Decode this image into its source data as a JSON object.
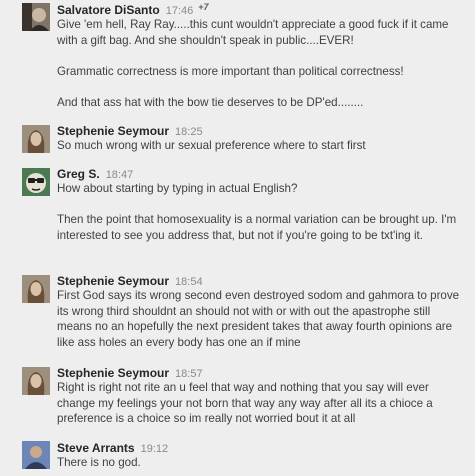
{
  "comments": [
    {
      "author": "Salvatore DiSanto",
      "time": "17:46",
      "plus_count": "+7",
      "lines": [
        "Give 'em hell, Ray Ray.....this cunt wouldn't appreciate a good fuck if it came with a gift bag. And she shouldn't speak in public....EVER!",
        "",
        "Grammatic correctness is more important than political correctness!",
        "",
        "And that ass hat with the bow tie deserves to be DP'ed........"
      ]
    },
    {
      "author": "Stephenie Seymour",
      "time": "18:25",
      "lines": [
        "So much wrong with ur sexual preference where to start first"
      ]
    },
    {
      "author": "Greg S.",
      "time": "18:47",
      "lines": [
        "How about starting by typing in actual English?",
        "",
        "Then the point that homosexuality is a normal variation can be brought up.  I'm interested to see you address that, but not if you're going to be txt'ing it."
      ]
    },
    {
      "author": "Stephenie Seymour",
      "time": "18:54",
      "lines": [
        "First God says its wrong second even destroyed sodom and gahmora to prove its wrong third shouldnt an should not with or with out the apastrophe still means no an hopefully the next president takes that away fourth opinions are like ass holes an every body has one an if mine"
      ]
    },
    {
      "author": "Stephenie Seymour",
      "time": "18:57",
      "lines": [
        "Right is right not rite an u feel that way and nothing that you say will ever change my feelings your not born that way any way after all its a chioce a preference is a choice so im really not worried bout it at all"
      ]
    },
    {
      "author": "Steve Arrants",
      "time": "19:12",
      "lines": [
        "There is no god."
      ]
    }
  ],
  "avatars": [
    {
      "icon": "person-photo-icon",
      "bg": "#6b5a4a"
    },
    {
      "icon": "person-photo-icon",
      "bg": "#8a7a66"
    },
    {
      "icon": "cartoon-glasses-face-icon",
      "bg": "#3f6a45"
    },
    {
      "icon": "person-photo-icon",
      "bg": "#8a7a66"
    },
    {
      "icon": "person-photo-icon",
      "bg": "#8a7a66"
    },
    {
      "icon": "person-photo-icon",
      "bg": "#5a6e9a"
    }
  ]
}
